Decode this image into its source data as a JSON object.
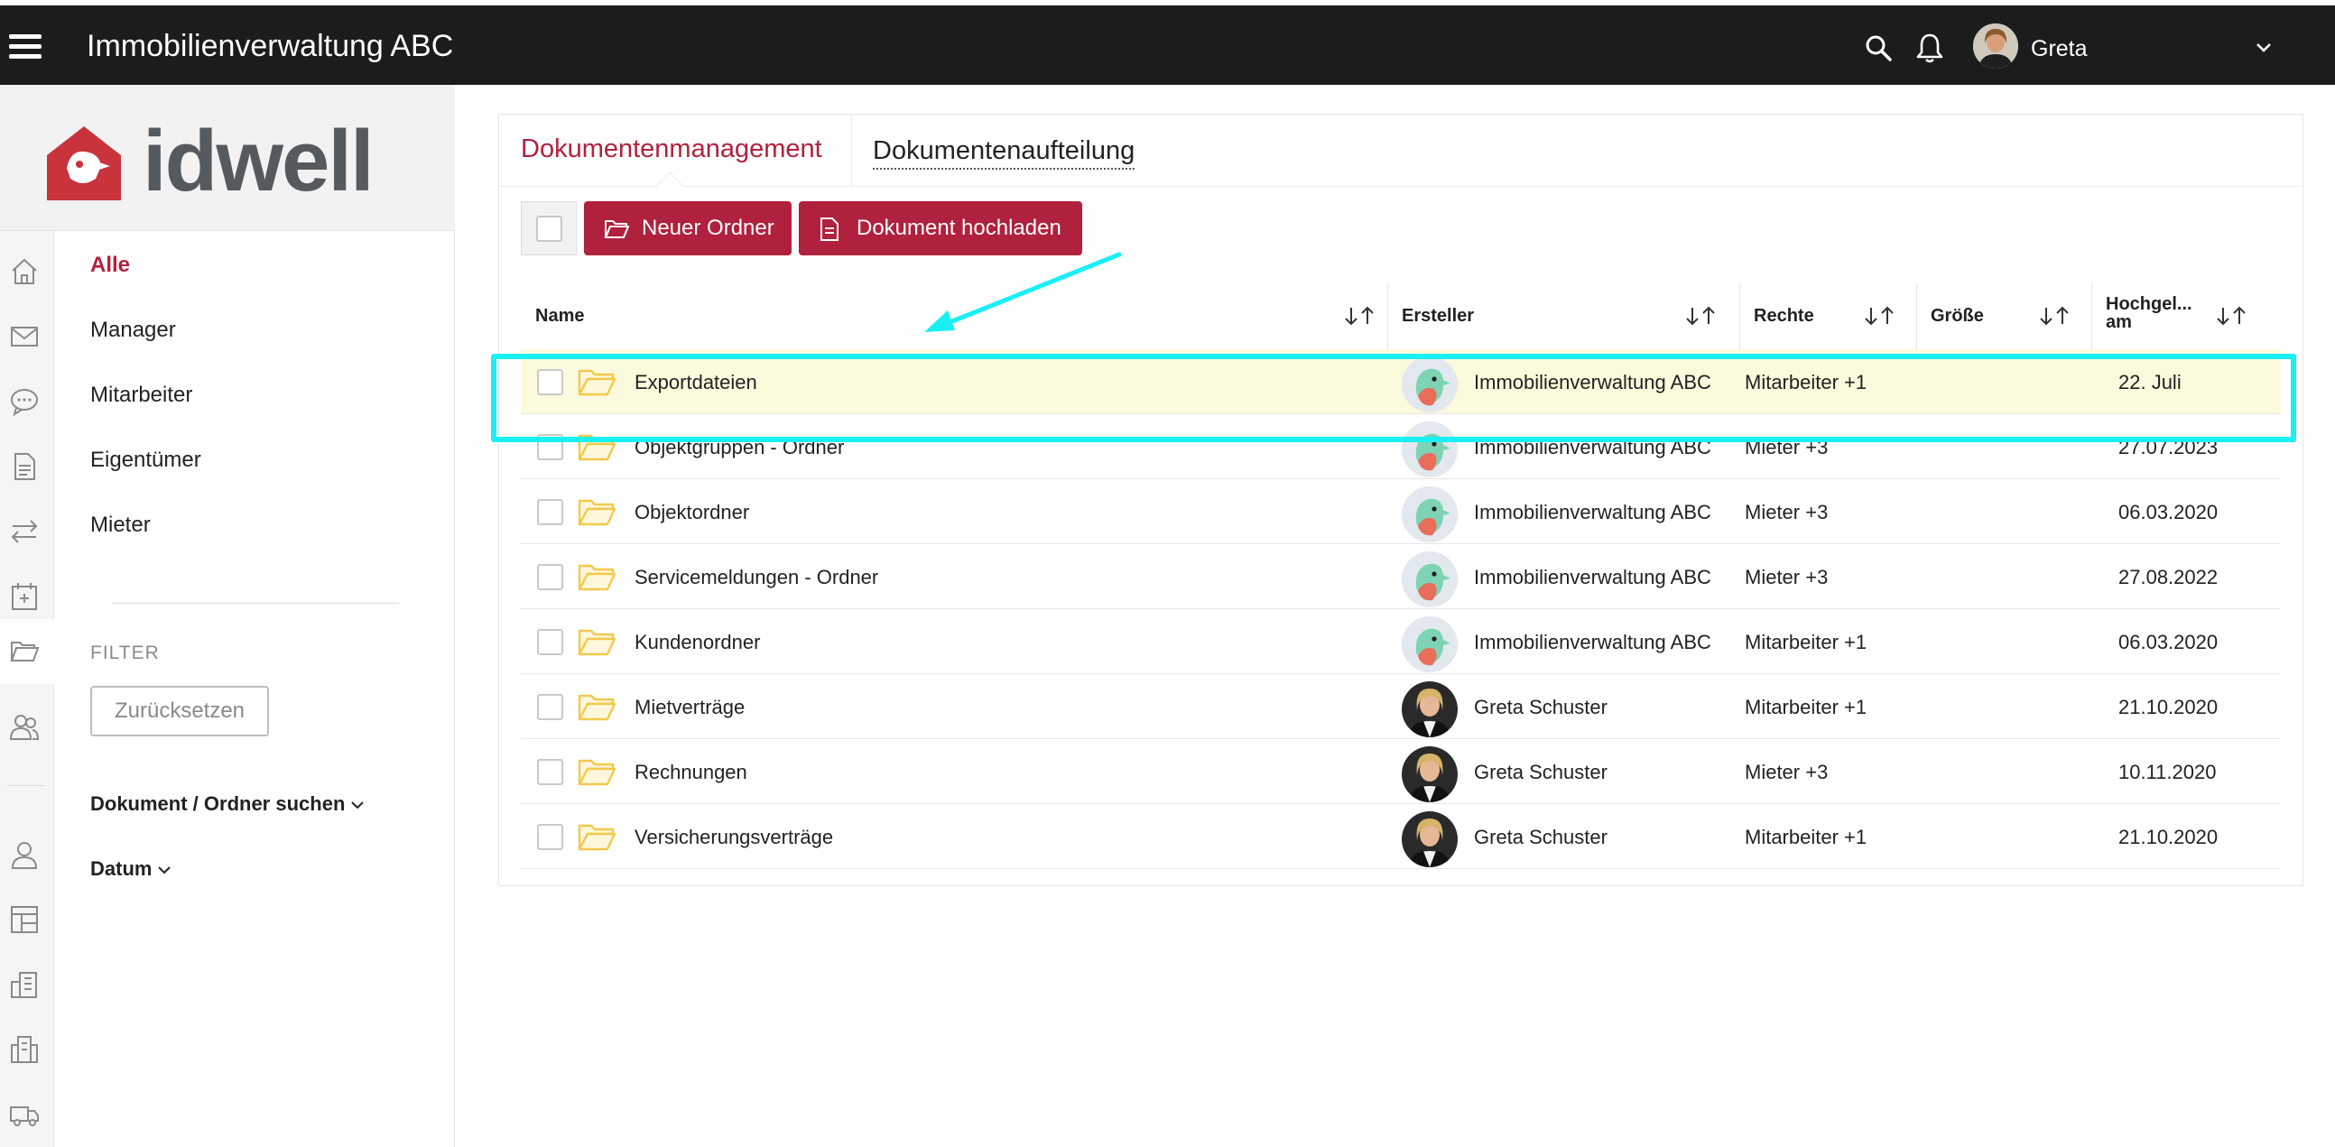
{
  "topbar": {
    "app_title": "Immobilienverwaltung ABC",
    "user_name": "Greta",
    "icons": [
      "hamburger-icon",
      "search-icon",
      "bell-icon",
      "chevron-down-icon"
    ]
  },
  "logo": {
    "text": "idwell",
    "brand_color": "#c9333c"
  },
  "sidebar": {
    "icons": [
      "home-icon",
      "mail-icon",
      "chat-icon",
      "document-icon",
      "transfer-icon",
      "calendar-icon",
      "folder-icon",
      "users-icon",
      "person-icon",
      "floorplan-icon",
      "building-icon",
      "buildings-icon",
      "truck-icon"
    ],
    "active_icon": "folder-icon",
    "items": [
      {
        "label": "Alle",
        "active": true
      },
      {
        "label": "Manager",
        "active": false
      },
      {
        "label": "Mitarbeiter",
        "active": false
      },
      {
        "label": "Eigentümer",
        "active": false
      },
      {
        "label": "Mieter",
        "active": false
      }
    ],
    "filter_label": "FILTER",
    "reset_label": "Zurücksetzen",
    "search_section": "Dokument / Ordner suchen",
    "date_section": "Datum"
  },
  "tabs": [
    {
      "label": "Dokumentenmanagement",
      "active": true
    },
    {
      "label": "Dokumentenaufteilung",
      "active": false
    }
  ],
  "toolbar": {
    "new_folder_label": "Neuer Ordner",
    "upload_label": "Dokument hochladen"
  },
  "table": {
    "columns": {
      "name": "Name",
      "creator": "Ersteller",
      "rights": "Rechte",
      "size": "Größe",
      "uploaded_line1": "Hochgel...",
      "uploaded_line2": "am"
    },
    "rows": [
      {
        "name": "Exportdateien",
        "creator": "Immobilienverwaltung ABC",
        "avatar": "bird",
        "rights": "Mitarbeiter +1",
        "size": "",
        "date": "22. Juli",
        "highlighted": true
      },
      {
        "name": "Objektgruppen - Ordner",
        "creator": "Immobilienverwaltung ABC",
        "avatar": "bird",
        "rights": "Mieter +3",
        "size": "",
        "date": "27.07.2023"
      },
      {
        "name": "Objektordner",
        "creator": "Immobilienverwaltung ABC",
        "avatar": "bird",
        "rights": "Mieter +3",
        "size": "",
        "date": "06.03.2020"
      },
      {
        "name": "Servicemeldungen - Ordner",
        "creator": "Immobilienverwaltung ABC",
        "avatar": "bird",
        "rights": "Mieter +3",
        "size": "",
        "date": "27.08.2022"
      },
      {
        "name": "Kundenordner",
        "creator": "Immobilienverwaltung ABC",
        "avatar": "bird",
        "rights": "Mitarbeiter +1",
        "size": "",
        "date": "06.03.2020"
      },
      {
        "name": "Mietverträge",
        "creator": "Greta Schuster",
        "avatar": "person",
        "rights": "Mitarbeiter +1",
        "size": "",
        "date": "21.10.2020"
      },
      {
        "name": "Rechnungen",
        "creator": "Greta Schuster",
        "avatar": "person",
        "rights": "Mieter +3",
        "size": "",
        "date": "10.11.2020"
      },
      {
        "name": "Versicherungsverträge",
        "creator": "Greta Schuster",
        "avatar": "person",
        "rights": "Mitarbeiter +1",
        "size": "",
        "date": "21.10.2020"
      }
    ]
  },
  "colors": {
    "accent": "#b0213d",
    "highlight_row": "#fcfadc",
    "annotation": "#19f0f3",
    "folder": "#f2c94c"
  }
}
